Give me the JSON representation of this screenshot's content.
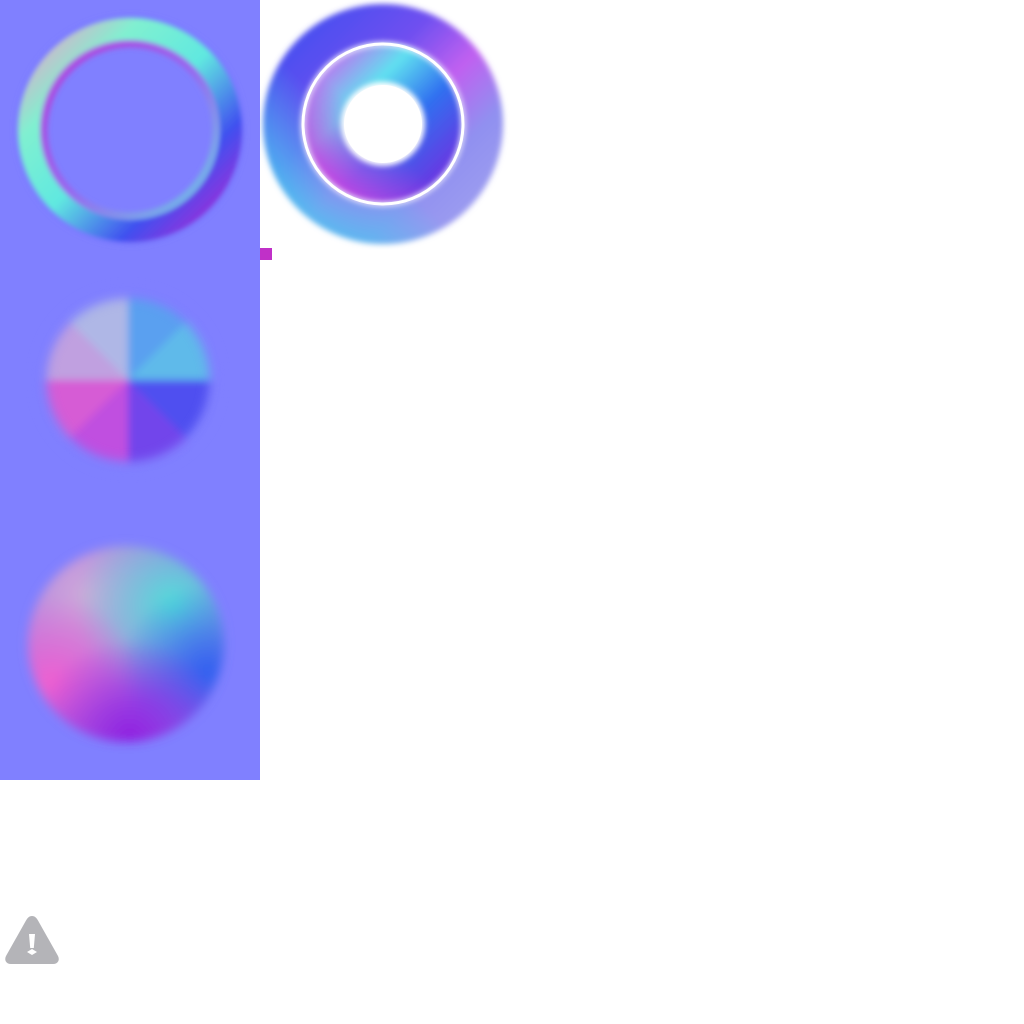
{
  "image": {
    "background_color": "#ffffff",
    "atlas_background_color": "#8080ff",
    "tiles": [
      {
        "name": "ring-normal-map",
        "shape": "ring"
      },
      {
        "name": "torus-normal-map",
        "shape": "torus"
      },
      {
        "name": "cone-normal-map",
        "shape": "cone"
      },
      {
        "name": "sphere-normal-map",
        "shape": "sphere"
      }
    ],
    "marker_color": "#c030c8",
    "warning_icon": {
      "icon": "warning-icon",
      "color": "#b4b4b8"
    }
  }
}
